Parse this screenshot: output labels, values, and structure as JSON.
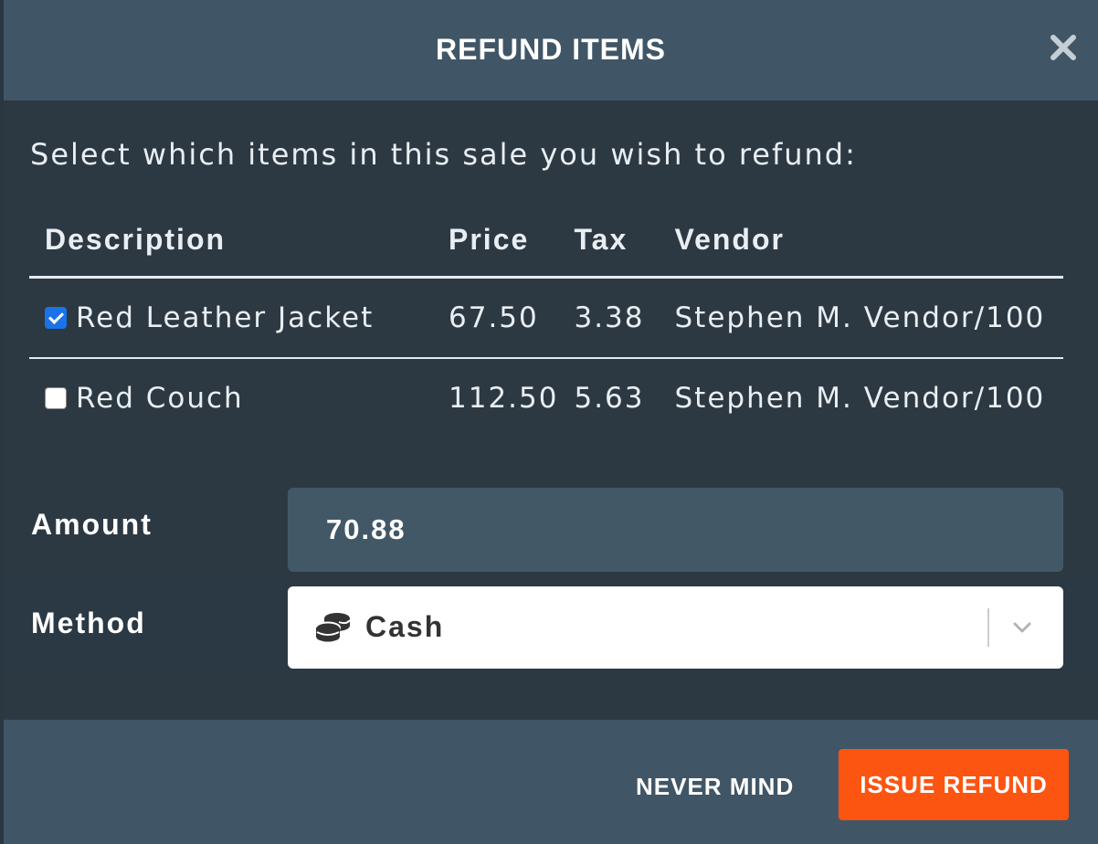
{
  "dialog": {
    "title": "REFUND ITEMS",
    "intro": "Select which items in this sale you wish to refund:"
  },
  "table": {
    "headers": {
      "description": "Description",
      "price": "Price",
      "tax": "Tax",
      "vendor": "Vendor"
    },
    "rows": [
      {
        "checked": true,
        "description": "Red Leather Jacket",
        "price": "67.50",
        "tax": "3.38",
        "vendor": "Stephen M. Vendor/100"
      },
      {
        "checked": false,
        "description": "Red Couch",
        "price": "112.50",
        "tax": "5.63",
        "vendor": "Stephen M. Vendor/100"
      }
    ]
  },
  "form": {
    "amount_label": "Amount",
    "amount_value": "70.88",
    "method_label": "Method",
    "method_value": "Cash"
  },
  "footer": {
    "cancel_label": "NEVER MIND",
    "submit_label": "ISSUE REFUND"
  },
  "icons": {
    "close": "close-icon",
    "method": "coins-icon",
    "dropdown": "chevron-down-icon"
  },
  "colors": {
    "header_bg": "#405666",
    "body_bg": "#2d3942",
    "accent": "#fc5511",
    "checkbox": "#1a73e8"
  }
}
